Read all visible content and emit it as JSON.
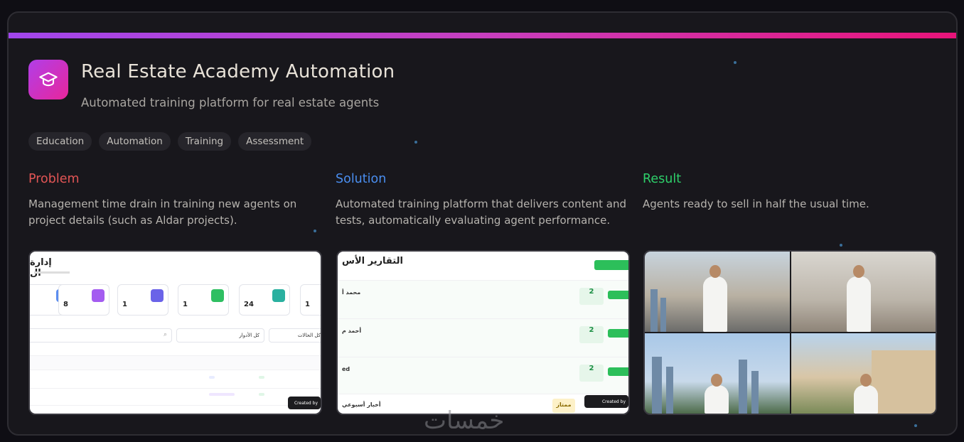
{
  "project": {
    "title": "Real Estate Academy Automation",
    "subtitle": "Automated training platform for real estate agents",
    "logo_icon": "graduation-cap-icon",
    "tags": [
      "Education",
      "Automation",
      "Training",
      "Assessment"
    ]
  },
  "sections": {
    "problem": {
      "heading": "Problem",
      "color": "#e25555",
      "text": "Management time drain in training new agents on project details (such as Aldar projects)."
    },
    "solution": {
      "heading": "Solution",
      "color": "#4a8ef0",
      "text": "Automated training platform that delivers content and tests, automatically evaluating agent performance."
    },
    "result": {
      "heading": "Result",
      "color": "#2ecf6a",
      "text": "Agents ready to sell in half the usual time."
    }
  },
  "screenshot1": {
    "heading": "إدارة ال",
    "kpis": [
      "8",
      "1",
      "1",
      "24",
      "1"
    ],
    "filter1": "كل الأدوار",
    "filter2": "كل الحالات",
    "badge": "Created by"
  },
  "screenshot2": {
    "heading": "التقارير الأس",
    "names": [
      "محمد أ",
      "أحمد م",
      "ed",
      "أخبار أسبوعي"
    ],
    "scores": [
      "2",
      "2",
      "2"
    ],
    "grade": "ممتاز",
    "badge": "Created by"
  },
  "watermark": "خمسات",
  "accent": {
    "gradient_start": "#a146ec",
    "gradient_end": "#e8147a"
  }
}
